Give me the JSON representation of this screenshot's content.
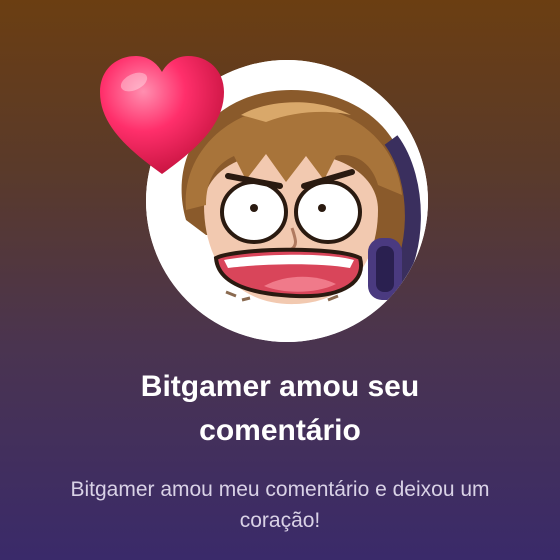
{
  "notification": {
    "title": "Bitgamer amou seu comentário",
    "message": "Bitgamer amou meu comentário e deixou um coração!",
    "avatar_icon": "cartoon-avatar-icon",
    "reaction_icon": "heart-icon"
  },
  "colors": {
    "background_top": "#6b3e12",
    "background_bottom": "#3a2a6a",
    "title": "#ffffff",
    "message": "#d9d2e6",
    "heart": "#ff2f6b"
  }
}
